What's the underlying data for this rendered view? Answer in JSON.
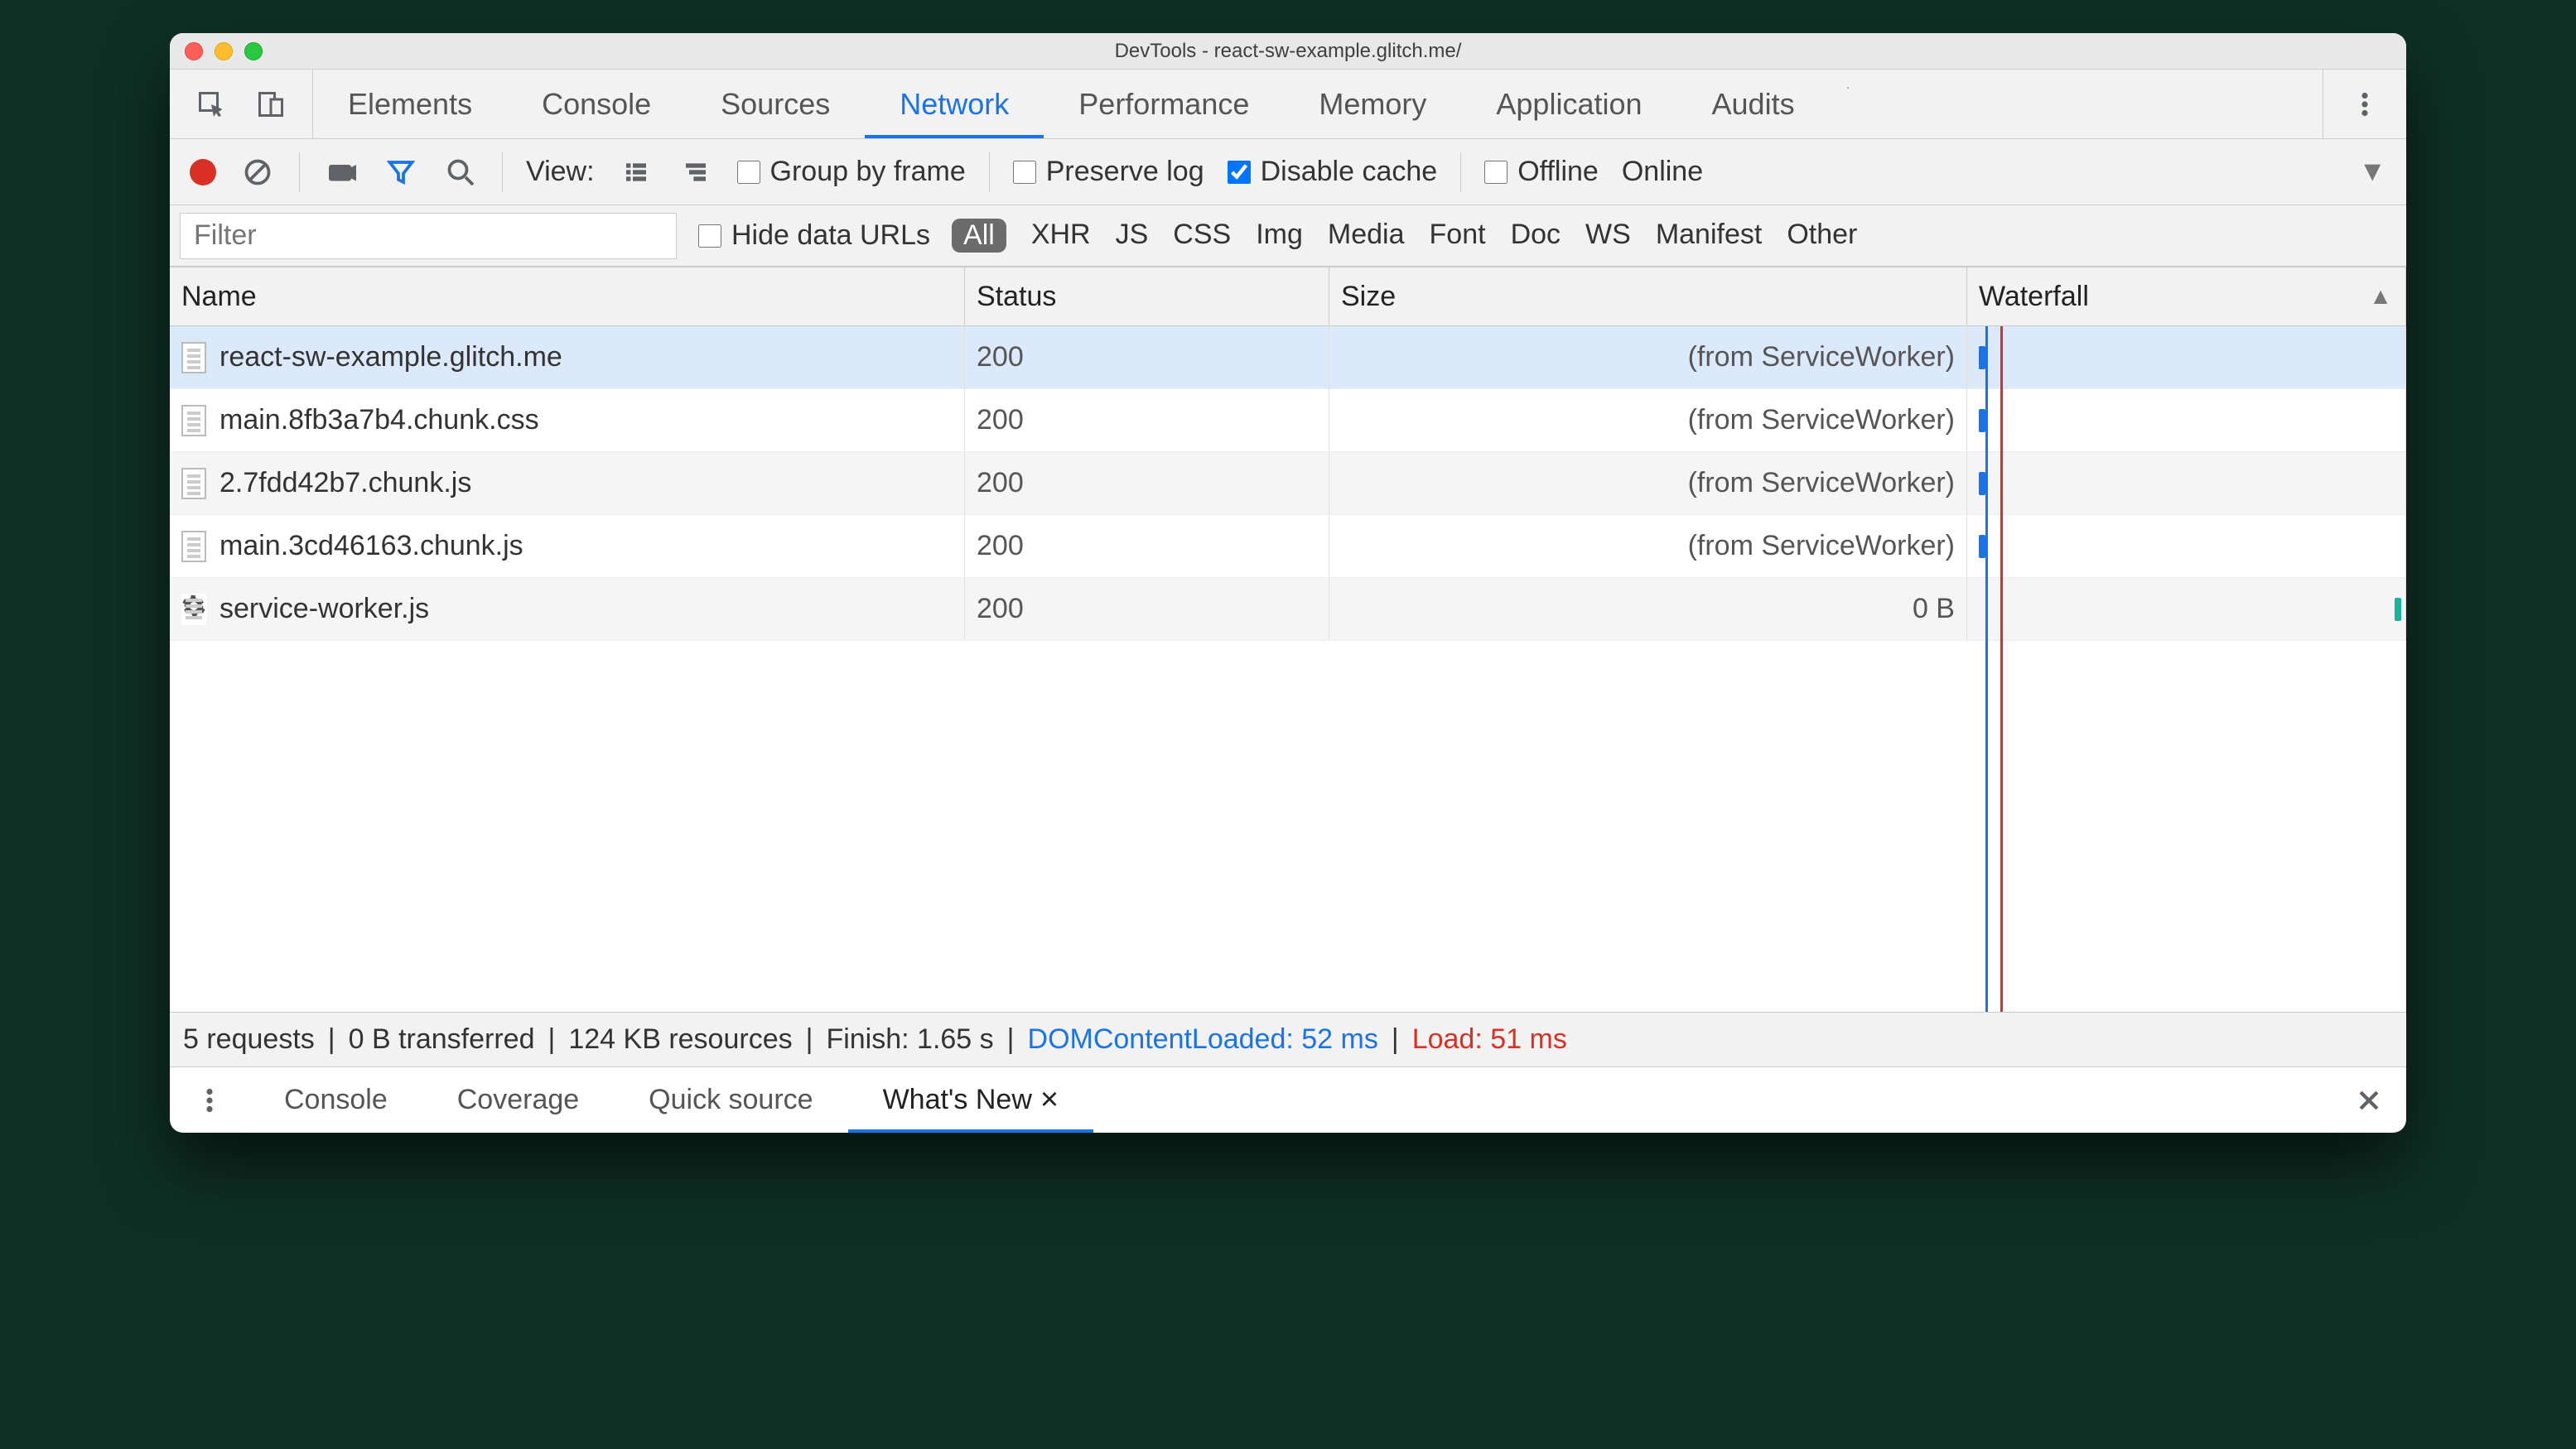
{
  "window": {
    "title": "DevTools - react-sw-example.glitch.me/"
  },
  "panels": {
    "items": [
      "Elements",
      "Console",
      "Sources",
      "Network",
      "Performance",
      "Memory",
      "Application",
      "Audits"
    ],
    "active": "Network"
  },
  "toolbar": {
    "view_label": "View:",
    "group_by_frame": "Group by frame",
    "preserve_log": "Preserve log",
    "disable_cache": "Disable cache",
    "disable_cache_checked": true,
    "offline": "Offline",
    "online": "Online"
  },
  "filterbar": {
    "placeholder": "Filter",
    "hide_data_urls": "Hide data URLs",
    "categories": [
      "All",
      "XHR",
      "JS",
      "CSS",
      "Img",
      "Media",
      "Font",
      "Doc",
      "WS",
      "Manifest",
      "Other"
    ],
    "active_category": "All"
  },
  "columns": {
    "name": "Name",
    "status": "Status",
    "size": "Size",
    "waterfall": "Waterfall"
  },
  "requests": [
    {
      "name": "react-sw-example.glitch.me",
      "status": "200",
      "size": "(from ServiceWorker)",
      "selected": true,
      "icon": "file"
    },
    {
      "name": "main.8fb3a7b4.chunk.css",
      "status": "200",
      "size": "(from ServiceWorker)",
      "selected": false,
      "icon": "file"
    },
    {
      "name": "2.7fdd42b7.chunk.js",
      "status": "200",
      "size": "(from ServiceWorker)",
      "selected": false,
      "icon": "file"
    },
    {
      "name": "main.3cd46163.chunk.js",
      "status": "200",
      "size": "(from ServiceWorker)",
      "selected": false,
      "icon": "file"
    },
    {
      "name": "service-worker.js",
      "status": "200",
      "size": "0 B",
      "selected": false,
      "icon": "gear"
    }
  ],
  "summary": {
    "requests": "5 requests",
    "transferred": "0 B transferred",
    "resources": "124 KB resources",
    "finish": "Finish: 1.65 s",
    "dcl": "DOMContentLoaded: 52 ms",
    "load": "Load: 51 ms"
  },
  "drawer": {
    "tabs": [
      "Console",
      "Coverage",
      "Quick source",
      "What's New"
    ],
    "active": "What's New"
  }
}
